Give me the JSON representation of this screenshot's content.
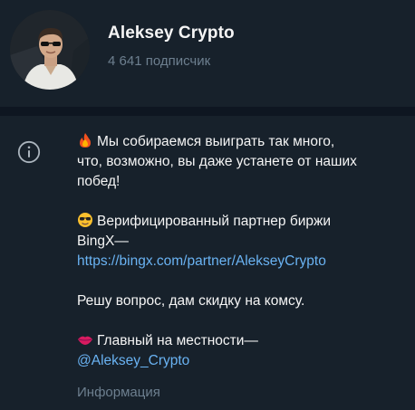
{
  "channel": {
    "name": "Aleksey Crypto",
    "subscribers": "4 641 подписчик"
  },
  "about": {
    "line1": "Мы собираемся выиграть так много,",
    "line2": "что, возможно, вы даже устанете от наших",
    "line3": "побед!",
    "partner_line1": "Верифицированный партнер биржи",
    "partner_line2": "BingX—",
    "partner_link": "https://bingx.com/partner/AlekseyCrypto",
    "discount": "Решу вопрос, дам скидку на комсу.",
    "local_line": "Главный на местности—",
    "username_link": "@Aleksey_Crypto",
    "label": "Информация"
  },
  "icons": {
    "info": "info-icon",
    "fire": "fire-emoji",
    "cool": "sunglasses-emoji",
    "lips": "lips-emoji"
  },
  "colors": {
    "background": "#17212b",
    "divider": "#0e1621",
    "link": "#6ab3f3",
    "muted": "#6d7f8f"
  }
}
